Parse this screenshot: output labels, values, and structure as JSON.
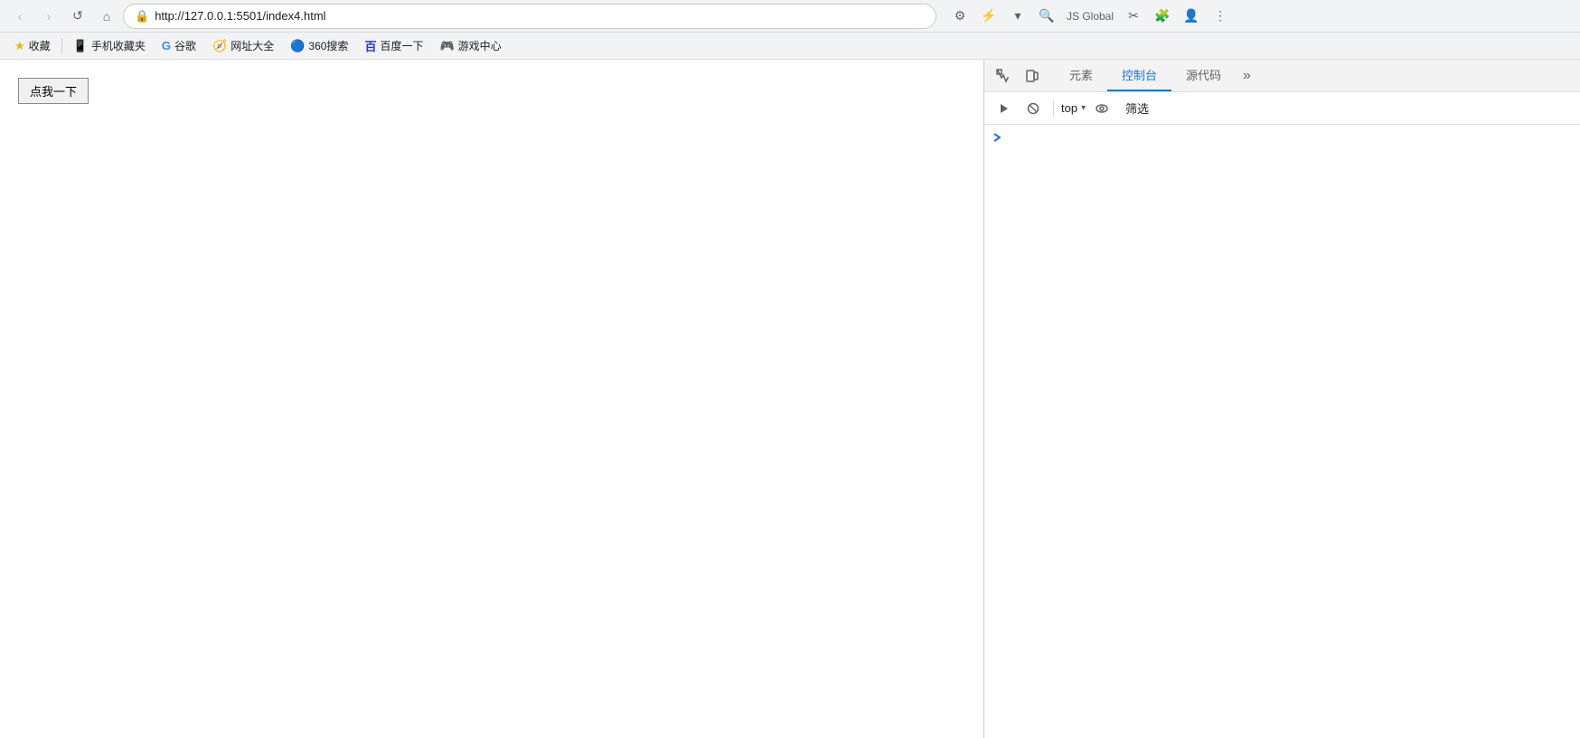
{
  "browser": {
    "url": "http://127.0.0.1:5501/index4.html",
    "back_disabled": true,
    "forward_disabled": true
  },
  "bookmarks": {
    "label": "收藏",
    "items": [
      {
        "label": "手机收藏夹",
        "icon": "📱"
      },
      {
        "label": "谷歌",
        "icon": "G"
      },
      {
        "label": "网址大全",
        "icon": "🧭"
      },
      {
        "label": "360搜索",
        "icon": "🔵"
      },
      {
        "label": "百度一下",
        "icon": "🅱"
      },
      {
        "label": "游戏中心",
        "icon": "🎮"
      }
    ]
  },
  "page": {
    "button_label": "点我一下"
  },
  "devtools": {
    "tabs": [
      {
        "label": "元素",
        "active": false
      },
      {
        "label": "控制台",
        "active": true
      },
      {
        "label": "源代码",
        "active": false
      }
    ],
    "more_label": "»",
    "toolbar": {
      "context_value": "top",
      "filter_label": "筛选"
    },
    "console": {
      "chevron": "›"
    }
  }
}
